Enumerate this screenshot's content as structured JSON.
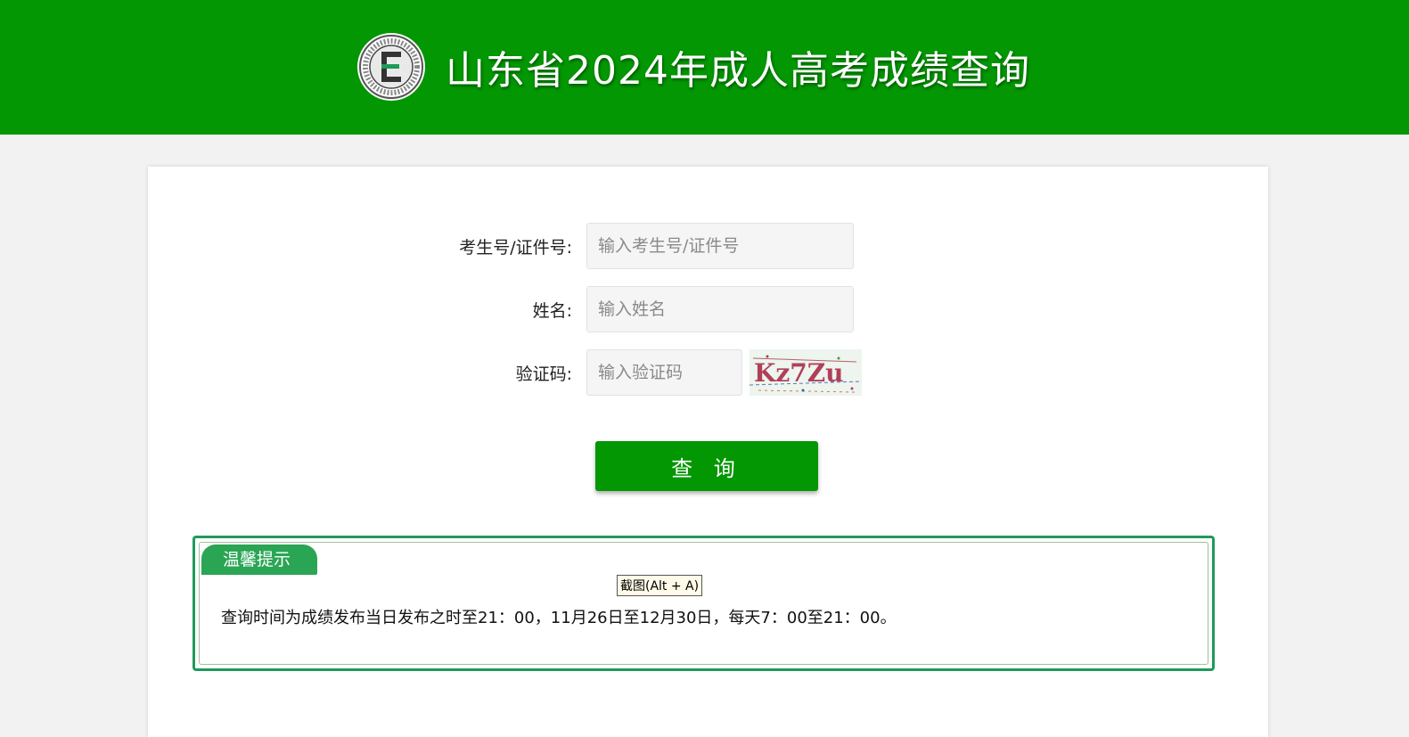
{
  "header": {
    "title": "山东省2024年成人高考成绩查询",
    "logo_icon": "exam-authority-seal-icon",
    "background_color": "#039703"
  },
  "form": {
    "exam_id": {
      "label": "考生号/证件号:",
      "placeholder": "输入考生号/证件号",
      "value": ""
    },
    "name": {
      "label": "姓名:",
      "placeholder": "输入姓名",
      "value": ""
    },
    "captcha": {
      "label": "验证码:",
      "placeholder": "输入验证码",
      "value": "",
      "image_text": "Kz7Zu"
    },
    "submit_label": "查 询"
  },
  "notice": {
    "tab_label": "温馨提示",
    "screenshot_tip": "截图(Alt + A)",
    "text": "查询时间为成绩发布当日发布之时至21：00，11月26日至12月30日，每天7：00至21：00。",
    "border_color": "#1e9a5a"
  }
}
